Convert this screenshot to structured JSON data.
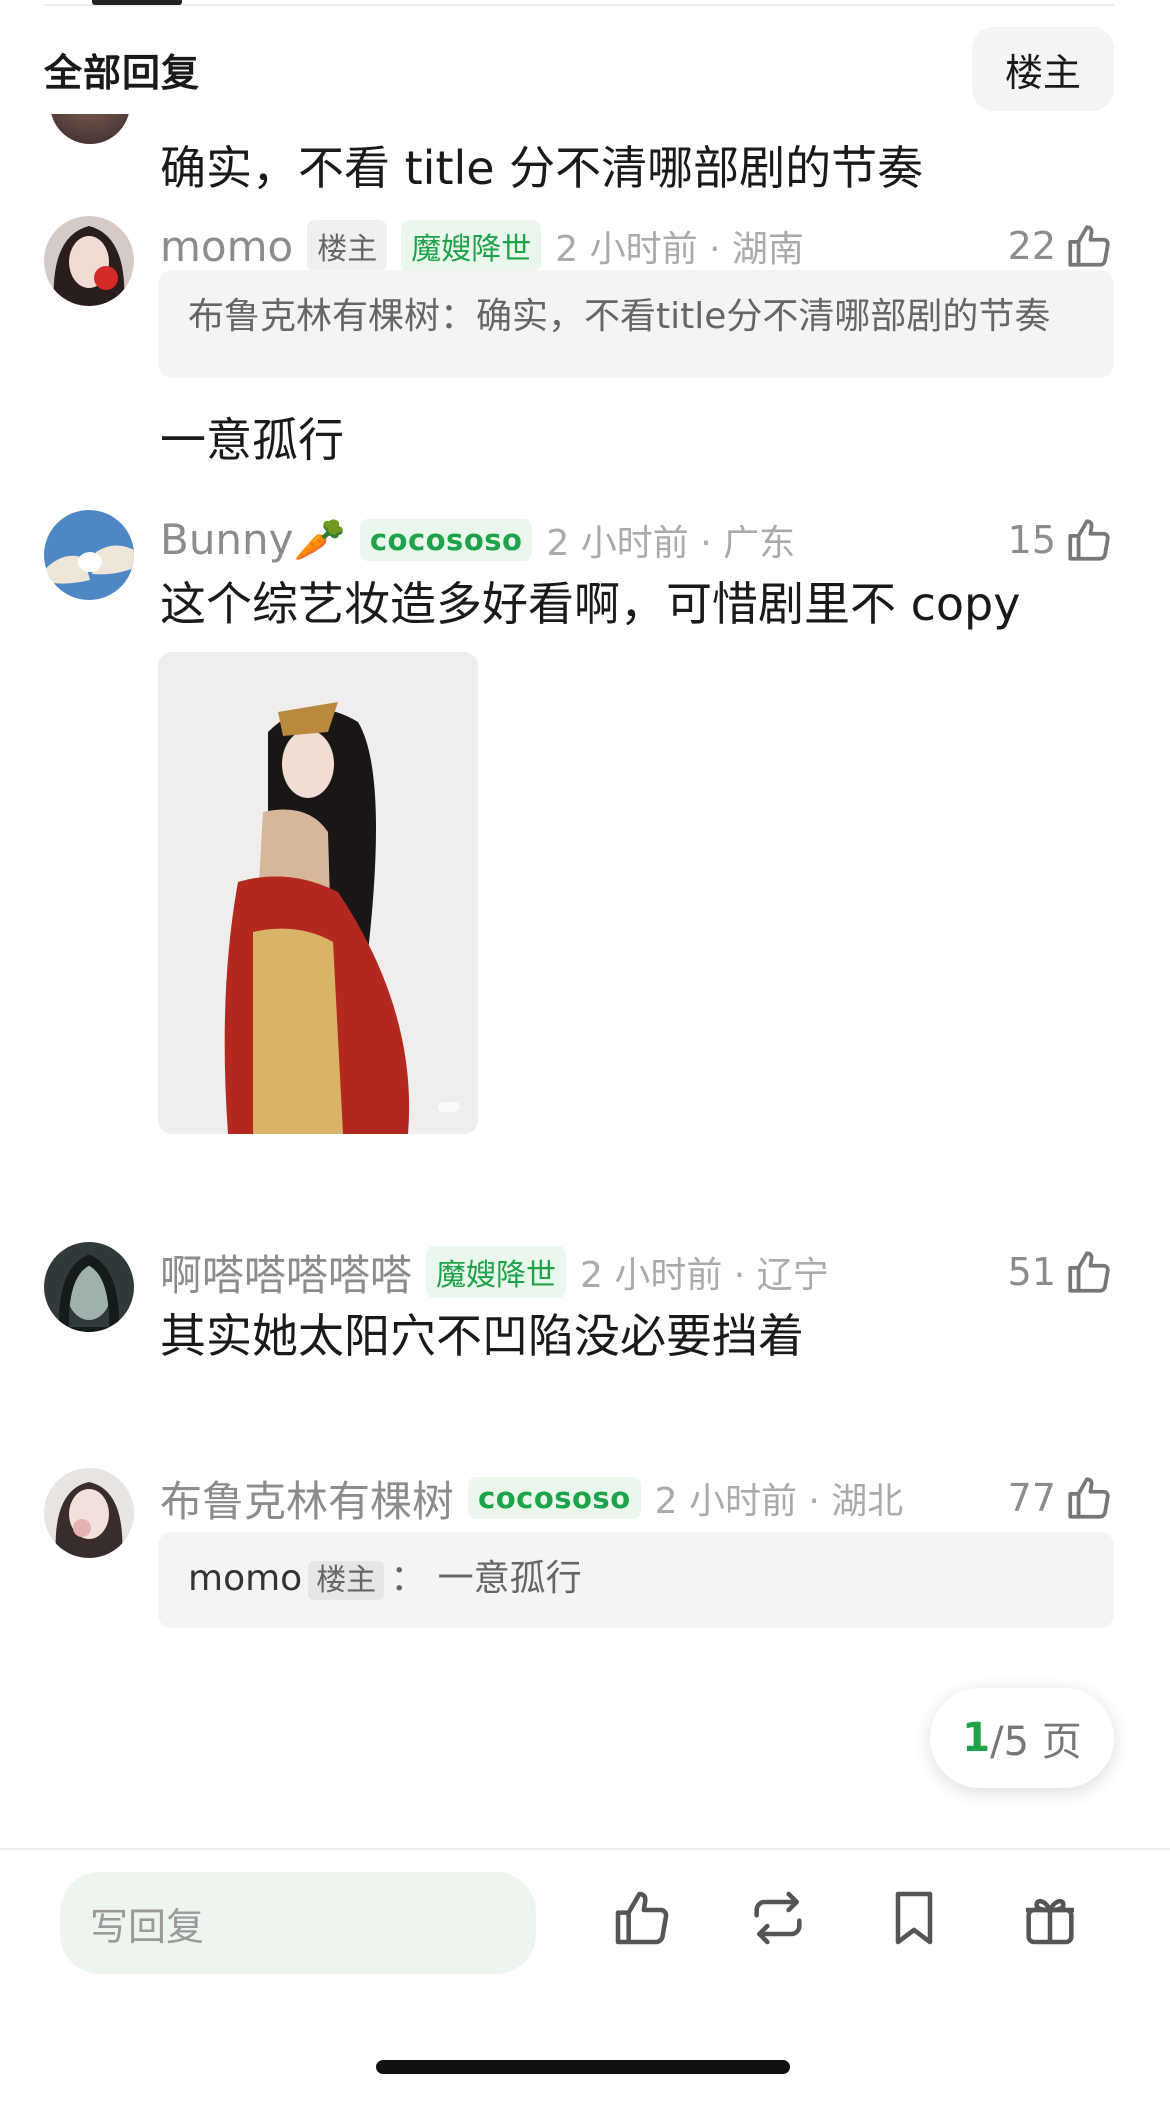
{
  "header": {
    "title": "全部回复",
    "owner_filter": "楼主"
  },
  "previous_comment": {
    "text": "确实，不看 title 分不清哪部剧的节奏"
  },
  "comments": [
    {
      "username": "momo",
      "owner_tag": "楼主",
      "badge": "魔嫂降世",
      "time_location": "2 小时前 · 湖南",
      "likes": "22",
      "quote": "布鲁克林有棵树：确实，不看title分不清哪部剧的节奏",
      "text": "一意孤行"
    },
    {
      "username": "Bunny🥕",
      "badge": "cocososo",
      "time_location": "2 小时前 · 广东",
      "likes": "15",
      "text": "这个综艺妆造多好看啊，可惜剧里不 copy",
      "image": "costume-photo"
    },
    {
      "username": "啊嗒嗒嗒嗒嗒",
      "badge": "魔嫂降世",
      "time_location": "2 小时前 · 辽宁",
      "likes": "51",
      "text": "其实她太阳穴不凹陷没必要挡着"
    },
    {
      "username": "布鲁克林有棵树",
      "badge": "cocososo",
      "time_location": "2 小时前 · 湖北",
      "likes": "77",
      "quote_name": "momo",
      "quote_tag": "楼主",
      "quote_text": "： 一意孤行"
    }
  ],
  "pager": {
    "current": "1",
    "rest": "/5 页"
  },
  "bottom_bar": {
    "reply_placeholder": "写回复",
    "actions": [
      "thumbs-up-icon",
      "repost-icon",
      "bookmark-icon",
      "gift-icon"
    ]
  },
  "colors": {
    "accent_green": "#1fa34a",
    "badge_bg": "#eaf7ec",
    "quote_bg": "#f4f4f4"
  }
}
